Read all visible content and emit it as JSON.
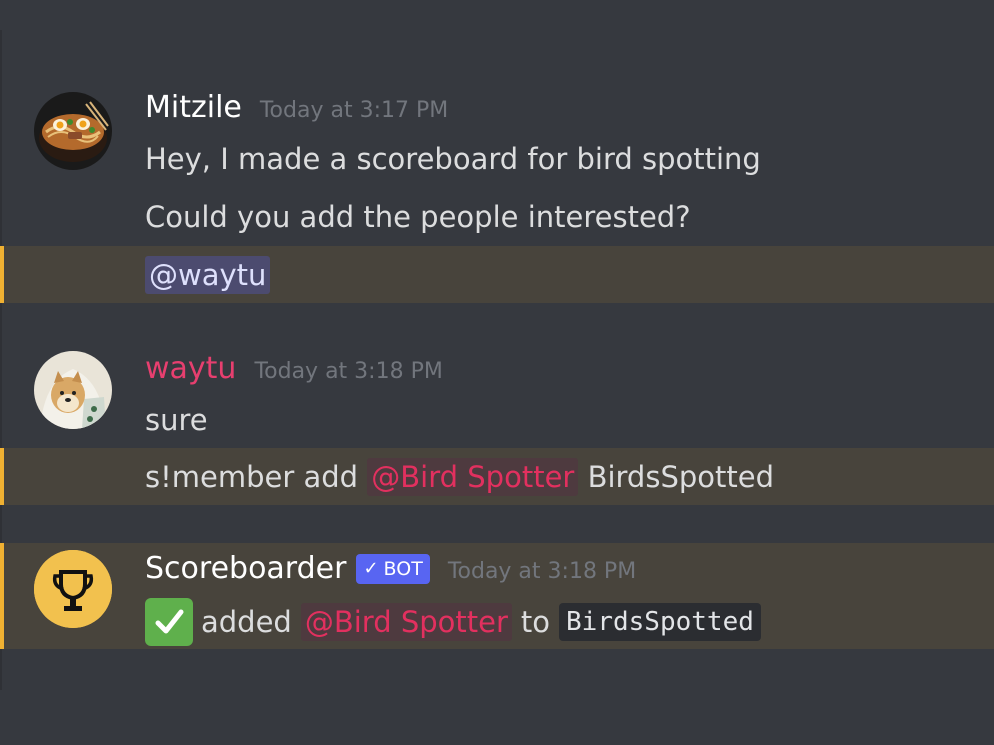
{
  "colors": {
    "background": "#36393f",
    "highlight_bg": "#48443c",
    "highlight_border": "#f0b132",
    "waytu_name": "#e73f6f",
    "role_mention": "#e2305f",
    "bot_badge": "#5865f2",
    "check_emoji": "#5fb04c"
  },
  "messages": [
    {
      "author": "Mitzile",
      "timestamp": "Today at 3:17 PM",
      "avatar_icon": "ramen-bowl-avatar",
      "lines": [
        "Hey, I made a scoreboard for bird spotting",
        "Could you add the people interested?"
      ],
      "mention_line": "@waytu"
    },
    {
      "author": "waytu",
      "timestamp": "Today at 3:18 PM",
      "avatar_icon": "shiba-dog-avatar",
      "lines": [
        "sure"
      ],
      "command": {
        "prefix": "s!member add",
        "role_mention": "@Bird Spotter",
        "board": "BirdsSpotted"
      }
    },
    {
      "author": "Scoreboarder",
      "badge": "BOT",
      "badge_check": "✓",
      "timestamp": "Today at 3:18 PM",
      "avatar_icon": "trophy-avatar",
      "result": {
        "emoji": "check-mark-emoji",
        "added": "added",
        "role_mention": "@Bird Spotter",
        "to": "to",
        "board_code": "BirdsSpotted"
      }
    }
  ]
}
